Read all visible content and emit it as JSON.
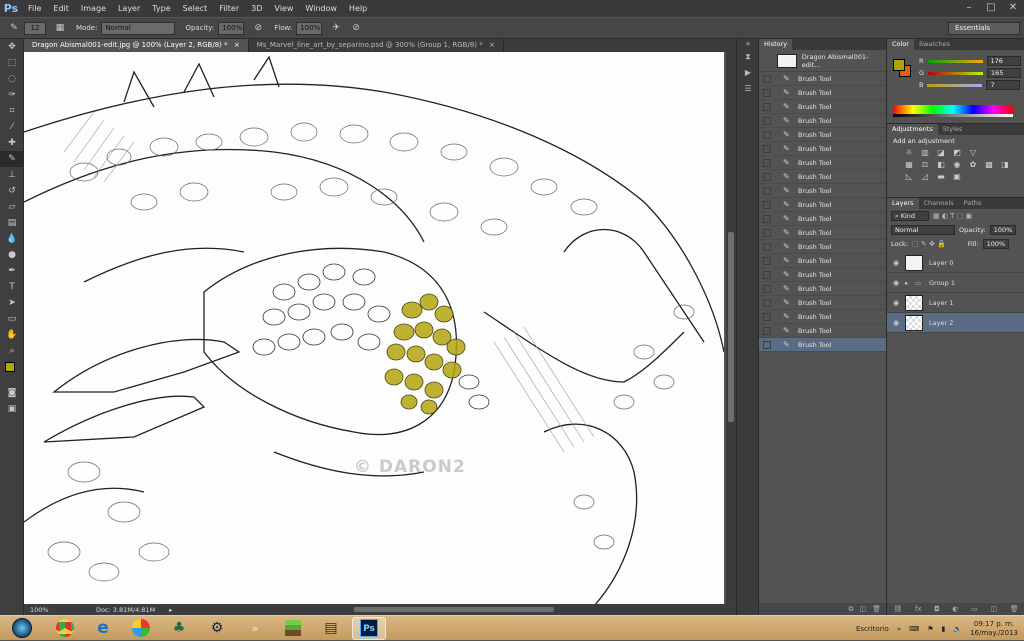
{
  "app": {
    "logo": "Ps"
  },
  "menu": [
    "File",
    "Edit",
    "Image",
    "Layer",
    "Type",
    "Select",
    "Filter",
    "3D",
    "View",
    "Window",
    "Help"
  ],
  "window_controls": {
    "minimize": "–",
    "maximize": "□",
    "close": "✕"
  },
  "options_bar": {
    "brush_size": "12",
    "mode_label": "Mode:",
    "mode_value": "Normal",
    "opacity_label": "Opacity:",
    "opacity_value": "100%",
    "flow_label": "Flow:",
    "flow_value": "100%",
    "workspace": "Essentials"
  },
  "tabs": [
    {
      "label": "Dragon Abismal001-edit.jpg @ 100% (Layer 2, RGB/8) *",
      "close": "×"
    },
    {
      "label": "Ms_Marvel_line_art_by_separino.psd @ 300% (Group 1, RGB/8) *",
      "close": "×"
    }
  ],
  "status": {
    "zoom": "100%",
    "doc": "Doc: 3.81M/4.81M"
  },
  "watermark": "© DARON2",
  "history": {
    "tab": "History",
    "snapshot": "Dragon Abismal001-edit...",
    "items": [
      "Brush Tool",
      "Brush Tool",
      "Brush Tool",
      "Brush Tool",
      "Brush Tool",
      "Brush Tool",
      "Brush Tool",
      "Brush Tool",
      "Brush Tool",
      "Brush Tool",
      "Brush Tool",
      "Brush Tool",
      "Brush Tool",
      "Brush Tool",
      "Brush Tool",
      "Brush Tool",
      "Brush Tool",
      "Brush Tool",
      "Brush Tool",
      "Brush Tool"
    ]
  },
  "color_panel": {
    "tabs": [
      "Color",
      "Swatches"
    ],
    "r_label": "R",
    "r": "176",
    "g_label": "G",
    "g": "165",
    "b_label": "B",
    "b": "7",
    "foreground": "#b0a507",
    "background": "#e06010"
  },
  "adjustments": {
    "tabs": [
      "Adjustments",
      "Styles"
    ],
    "title": "Add an adjustment"
  },
  "layers_panel": {
    "tabs": [
      "Layers",
      "Channels",
      "Paths"
    ],
    "kind": "Kind",
    "blend": "Normal",
    "opacity_label": "Opacity:",
    "opacity": "100%",
    "lock_label": "Lock:",
    "fill_label": "Fill:",
    "fill": "100%",
    "layers": [
      {
        "name": "Layer 0"
      },
      {
        "name": "Group 1"
      },
      {
        "name": "Layer 1"
      },
      {
        "name": "Layer 2"
      }
    ]
  },
  "taskbar": {
    "tray_label": "Escritorio",
    "time": "09:17 p. m.",
    "date": "16/may./2013"
  }
}
